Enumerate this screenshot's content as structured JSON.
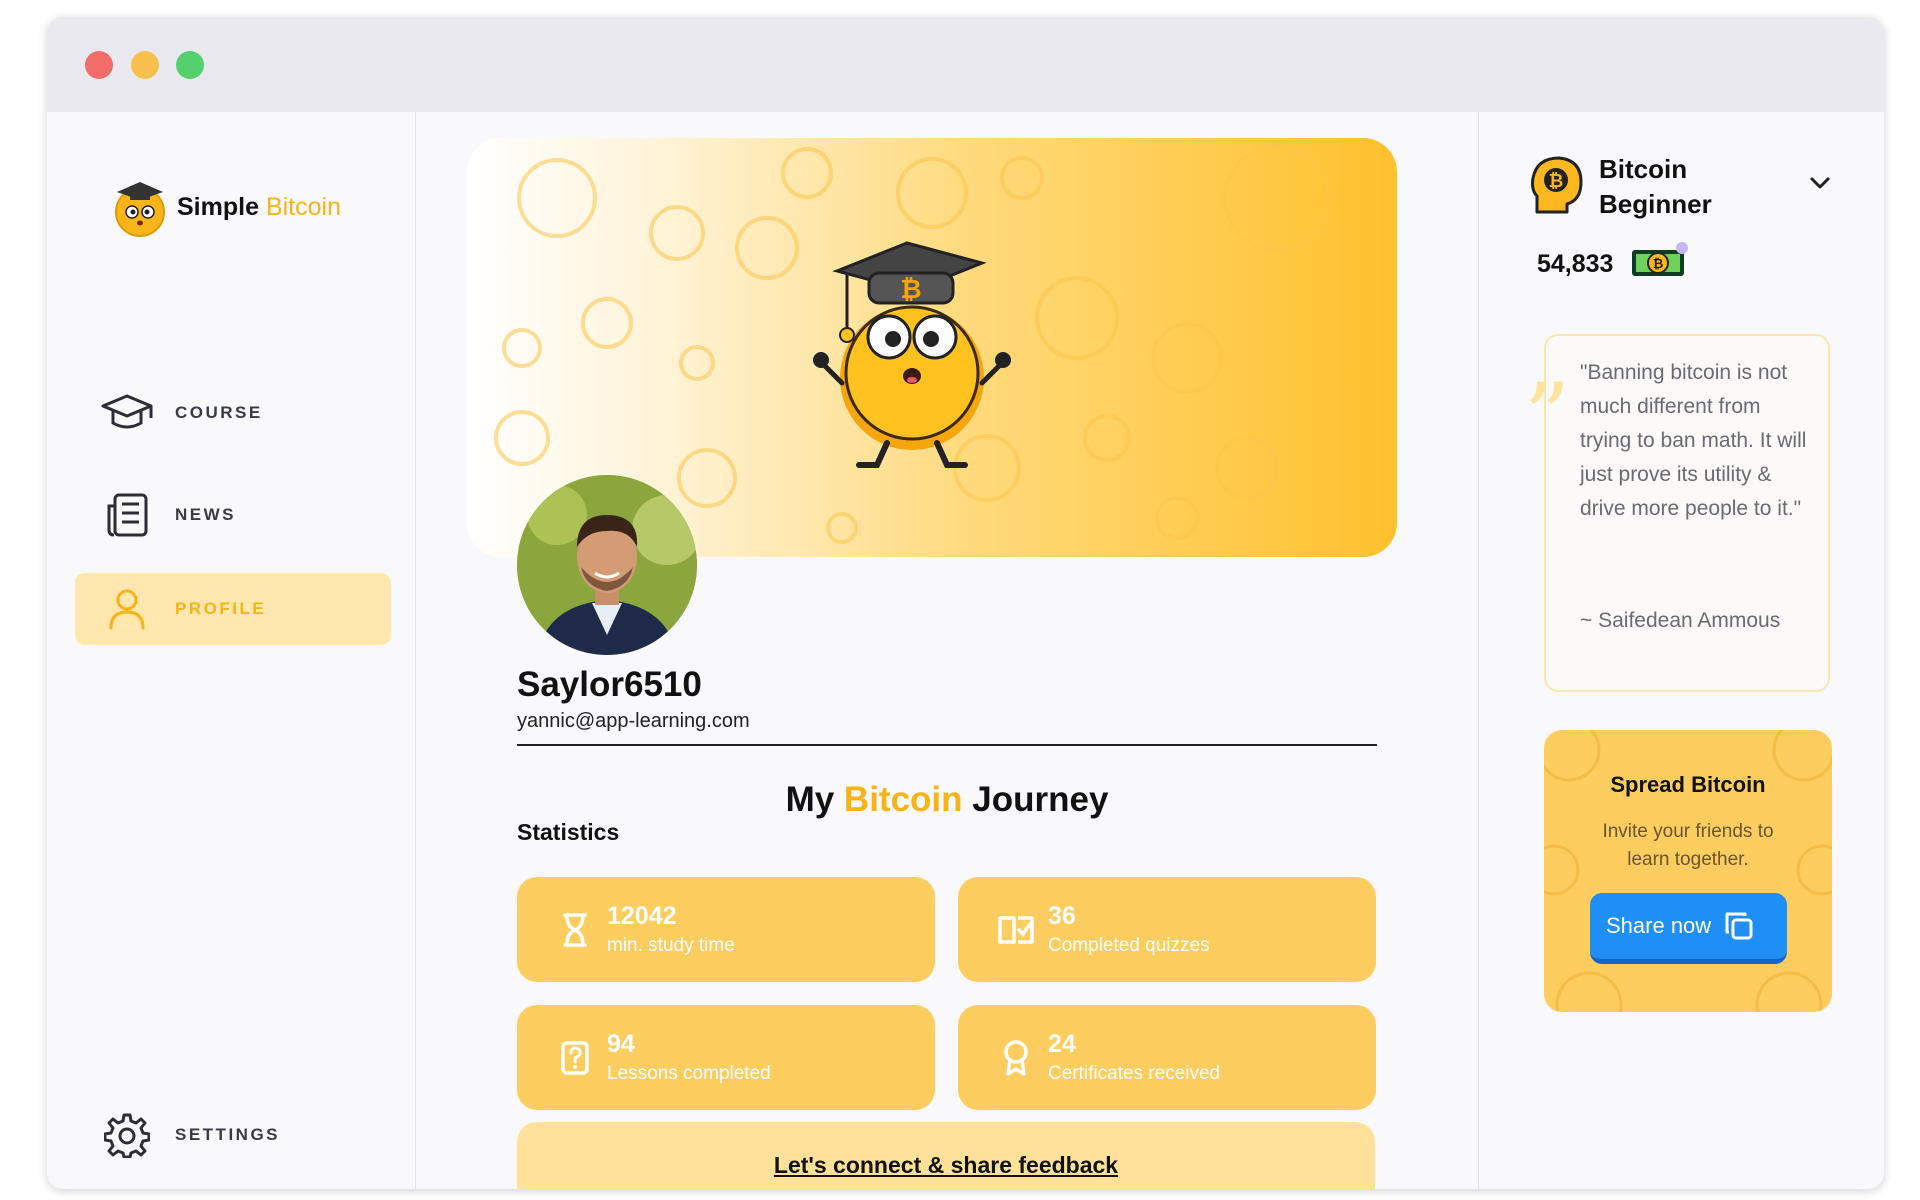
{
  "window": {
    "controls": [
      "close",
      "minimize",
      "maximize"
    ]
  },
  "logo": {
    "word1": "Simple",
    "word2": "Bitcoin"
  },
  "nav": {
    "items": [
      {
        "label": "COURSE",
        "icon": "graduation-cap-icon",
        "active": false
      },
      {
        "label": "NEWS",
        "icon": "newspaper-icon",
        "active": false
      },
      {
        "label": "PROFILE",
        "icon": "user-icon",
        "active": true
      }
    ],
    "settings": {
      "label": "SETTINGS",
      "icon": "gear-icon"
    }
  },
  "profile": {
    "username": "Saylor6510",
    "email": "yannic@app-learning.com"
  },
  "journey": {
    "title_before": "My ",
    "title_accent": "Bitcoin",
    "title_after": " Journey",
    "stats_label": "Statistics",
    "stats": [
      {
        "value": "12042",
        "caption": "min. study time",
        "icon": "hourglass-icon"
      },
      {
        "value": "36",
        "caption": "Completed quizzes",
        "icon": "book-check-icon"
      },
      {
        "value": "94",
        "caption": "Lessons completed",
        "icon": "question-doc-icon"
      },
      {
        "value": "24",
        "caption": "Certificates received",
        "icon": "award-icon"
      }
    ],
    "feedback_link": "Let's connect & share feedback"
  },
  "level": {
    "name": "Bitcoin Beginner",
    "points": "54,833"
  },
  "quote": {
    "text": "\"Banning bitcoin is not much different from trying to ban math. It will just prove its utility & drive more people to it.\"",
    "author": "~ Saifedean Ammous"
  },
  "spread": {
    "title": "Spread Bitcoin",
    "text": "Invite your friends to learn together.",
    "button": "Share now"
  },
  "colors": {
    "accent": "#f8b417",
    "card": "#fecd5f",
    "active_nav": "#ffe7ad",
    "button": "#1f8ef5"
  }
}
